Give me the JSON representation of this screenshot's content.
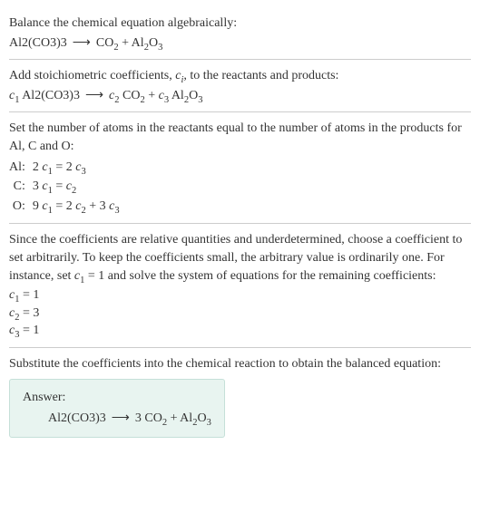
{
  "section1": {
    "prompt": "Balance the chemical equation algebraically:",
    "lhs": "Al2(CO3)3",
    "rhs1": "CO",
    "rhs2": "Al",
    "rhs2b": "O"
  },
  "section2": {
    "prompt_a": "Add stoichiometric coefficients, ",
    "prompt_c": "c",
    "prompt_i": "i",
    "prompt_b": ", to the reactants and products:",
    "c1": "c",
    "s1": "1",
    "sp1": " Al2(CO3)3",
    "c2": "c",
    "s2": "2",
    "sp2": " CO",
    "sp2s": "2",
    "plus": " + ",
    "c3": "c",
    "s3": "3",
    "sp3": " Al",
    "sp3s": "2",
    "sp3b": "O",
    "sp3bs": "3"
  },
  "section3": {
    "prompt": "Set the number of atoms in the reactants equal to the number of atoms in the products for Al, C and O:",
    "rows": [
      {
        "el": "Al:",
        "eq1": "2 ",
        "c1": "c",
        "s1": "1",
        "mid": " = 2 ",
        "c2": "c",
        "s2": "3",
        "tail": ""
      },
      {
        "el": "C:",
        "eq1": "3 ",
        "c1": "c",
        "s1": "1",
        "mid": " = ",
        "c2": "c",
        "s2": "2",
        "tail": ""
      },
      {
        "el": "O:",
        "eq1": "9 ",
        "c1": "c",
        "s1": "1",
        "mid": " = 2 ",
        "c2": "c",
        "s2": "2",
        "tail_pre": " + 3 ",
        "c3": "c",
        "s3": "3"
      }
    ]
  },
  "section4": {
    "prompt_a": "Since the coefficients are relative quantities and underdetermined, choose a coefficient to set arbitrarily. To keep the coefficients small, the arbitrary value is ordinarily one. For instance, set ",
    "cset": "c",
    "cset_s": "1",
    "cset_eq": " = 1",
    "prompt_b": " and solve the system of equations for the remaining coefficients:",
    "coeffs": [
      {
        "c": "c",
        "s": "1",
        "eq": " = 1"
      },
      {
        "c": "c",
        "s": "2",
        "eq": " = 3"
      },
      {
        "c": "c",
        "s": "3",
        "eq": " = 1"
      }
    ]
  },
  "section5": {
    "prompt": "Substitute the coefficients into the chemical reaction to obtain the balanced equation:",
    "answer_label": "Answer:",
    "lhs": "Al2(CO3)3",
    "rhs_coef": "3 CO",
    "rhs_s": "2",
    "plus": " + Al",
    "al_s": "2",
    "o": "O",
    "o_s": "3"
  }
}
